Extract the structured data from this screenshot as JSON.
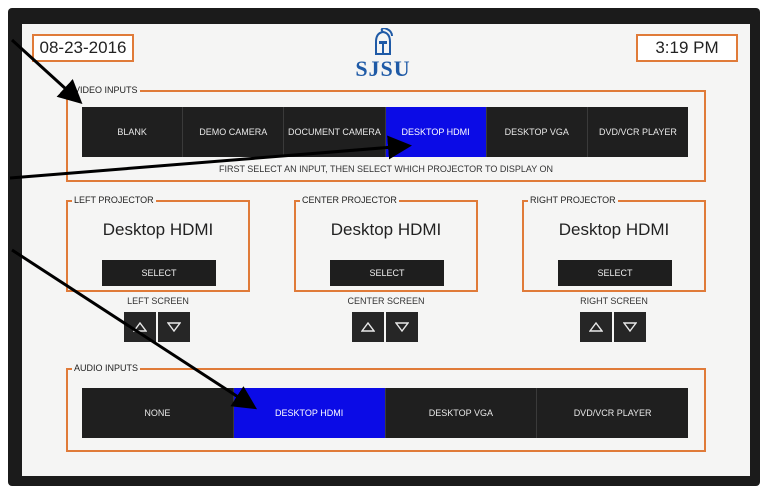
{
  "header": {
    "date": "08-23-2016",
    "time": "3:19 PM",
    "logo_text": "SJSU"
  },
  "video_inputs": {
    "label": "VIDEO INPUTS",
    "options": [
      "BLANK",
      "DEMO CAMERA",
      "DOCUMENT CAMERA",
      "DESKTOP HDMI",
      "DESKTOP VGA",
      "DVD/VCR PLAYER"
    ],
    "selected": "DESKTOP HDMI",
    "hint": "FIRST SELECT AN INPUT, THEN SELECT WHICH PROJECTOR TO DISPLAY ON"
  },
  "projectors": [
    {
      "label": "LEFT PROJECTOR",
      "source": "Desktop HDMI",
      "select_label": "SELECT",
      "screen_label": "LEFT SCREEN"
    },
    {
      "label": "CENTER PROJECTOR",
      "source": "Desktop HDMI",
      "select_label": "SELECT",
      "screen_label": "CENTER SCREEN"
    },
    {
      "label": "RIGHT PROJECTOR",
      "source": "Desktop HDMI",
      "select_label": "SELECT",
      "screen_label": "RIGHT SCREEN"
    }
  ],
  "audio_inputs": {
    "label": "AUDIO INPUTS",
    "options": [
      "NONE",
      "DESKTOP HDMI",
      "DESKTOP VGA",
      "DVD/VCR PLAYER"
    ],
    "selected": "DESKTOP HDMI"
  },
  "icons": {
    "up": "triangle-up-icon",
    "down": "triangle-down-icon",
    "logo": "spartan-helmet-icon"
  },
  "colors": {
    "accent": "#e07b39",
    "active": "#0b0be6",
    "button": "#1f1f1f",
    "logo": "#1f5aa6"
  }
}
